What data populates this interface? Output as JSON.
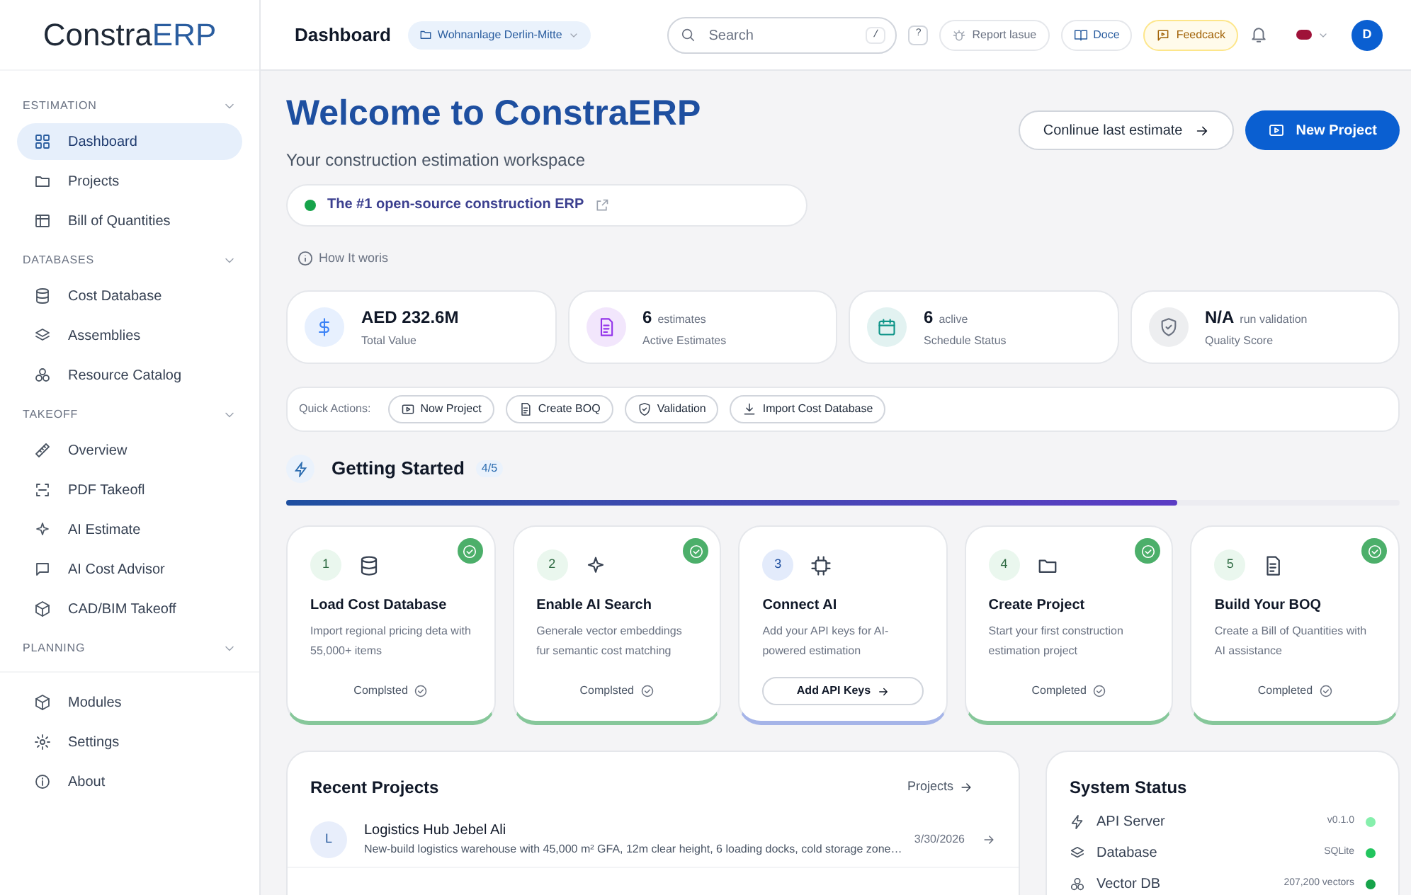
{
  "sidebar": {
    "logo": {
      "part1": "Constra",
      "part2": "ERP"
    },
    "sections": [
      {
        "title": "ESTIMATION",
        "items": [
          {
            "label": "Dashboard",
            "selected": true
          },
          {
            "label": "Projects",
            "selected": false
          },
          {
            "label": "Bill of Quantities",
            "selected": false
          }
        ]
      },
      {
        "title": "DATABASES",
        "items": [
          {
            "label": "Cost Database",
            "selected": false
          },
          {
            "label": "Assemblies",
            "selected": false
          },
          {
            "label": "Resource Catalog",
            "selected": false
          }
        ]
      },
      {
        "title": "TAKEOFF",
        "items": [
          {
            "label": "Overview",
            "selected": false
          },
          {
            "label": "PDF Takeofl",
            "selected": false
          },
          {
            "label": "AI Estimate",
            "selected": false
          },
          {
            "label": "AI Cost Advisor",
            "selected": false
          },
          {
            "label": "CAD/BIM Takeoff",
            "selected": false
          }
        ]
      },
      {
        "title": "PLANNING"
      }
    ],
    "footer_items": [
      {
        "label": "Modules",
        "selected": false
      },
      {
        "label": "Settings",
        "selected": false
      },
      {
        "label": "About",
        "selected": false
      }
    ]
  },
  "header": {
    "title": "Dashboard",
    "project": "Wohnanlage Derlin-Mitte",
    "search": {
      "placeholder": "Search",
      "shortcut": "/"
    },
    "help": "?",
    "report": "Report lasue",
    "docs": "Doce",
    "feedback": "Feedcack",
    "avatar": "D"
  },
  "hero": {
    "title": "Welcome to ConstraERP",
    "subtitle": "Your construction estimation workspace",
    "badge": "The #1 open-source construction ERP",
    "how": "How It woris",
    "secondary_button": "Conlinue last estimate",
    "primary_button": "New Project"
  },
  "stats": [
    {
      "value": "AED 232.6M",
      "label": "Total Value",
      "color": "#3b82f6"
    },
    {
      "value": "6",
      "unit": "estimates",
      "label": "Active Estimates",
      "color": "#9333ea"
    },
    {
      "value": "6",
      "unit": "aclive",
      "label": "Schedule Status",
      "color": "#0d9488"
    },
    {
      "value": "N/A",
      "unit": "run validation",
      "label": "Quality Score",
      "color": "#6b7280"
    }
  ],
  "quick_actions": {
    "label": "Quick Actions:",
    "actions": [
      "Now Project",
      "Create BOQ",
      "Validation",
      "Import Cost Database"
    ]
  },
  "getting_started": {
    "title": "Getting Started",
    "count": "4/5",
    "level": 0.8,
    "steps": [
      {
        "number": "1",
        "title": "Load Cost Database",
        "description": "Import regional pricing deta with 55,000+ items",
        "completed": true,
        "status": "Complsted"
      },
      {
        "number": "2",
        "title": "Enable AI Search",
        "description": "Generale vector embeddings fur semantic cost matching",
        "completed": true,
        "status": "Complsted"
      },
      {
        "number": "3",
        "title": "Connect AI",
        "description": "Add your API keys for AI-powered estimation",
        "completed": false,
        "action": "Add API Keys"
      },
      {
        "number": "4",
        "title": "Create Project",
        "description": "Start your first construction estimation project",
        "completed": true,
        "status": "Completed"
      },
      {
        "number": "5",
        "title": "Build Your BOQ",
        "description": "Create a Bill of Quantities with AI assistance",
        "completed": true,
        "status": "Completed"
      }
    ]
  },
  "recent_projects": {
    "title": "Recent Projects",
    "link": "Projects",
    "rows": [
      {
        "initial": "L",
        "name": "Logistics Hub Jebel Ali",
        "description": "New-build logistics warehouse with 45,000 m² GFA, 12m clear height, 6 loading docks, cold storage zone…",
        "date": "3/30/2026"
      }
    ]
  },
  "system_status": {
    "title": "System Status",
    "rows": [
      {
        "name": "API Server",
        "value": "v0.1.0",
        "color": "#86efac"
      },
      {
        "name": "Database",
        "value": "SQLite",
        "color": "#22c55e"
      },
      {
        "name": "Vector DB",
        "value": "207,200 vectors",
        "color": "#16a34a"
      }
    ]
  }
}
